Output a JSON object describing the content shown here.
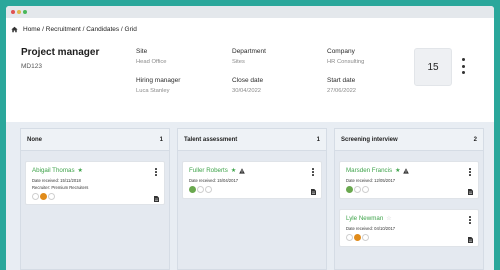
{
  "breadcrumb": [
    "Home",
    "Recruitment",
    "Candidates",
    "Grid"
  ],
  "breadcrumb_separator": " / ",
  "job": {
    "title": "Project manager",
    "code": "MD123",
    "count": "15"
  },
  "fields": {
    "site": {
      "label": "Site",
      "value": "Head Office"
    },
    "department": {
      "label": "Department",
      "value": "Sites"
    },
    "company": {
      "label": "Company",
      "value": "HR Consulting"
    },
    "hiring_manager": {
      "label": "Hiring manager",
      "value": "Luca Stanley"
    },
    "close_date": {
      "label": "Close date",
      "value": "30/04/2022"
    },
    "start_date": {
      "label": "Start date",
      "value": "27/06/2022"
    }
  },
  "columns": [
    {
      "title": "None",
      "count": "1"
    },
    {
      "title": "Talent assessment",
      "count": "1"
    },
    {
      "title": "Screening interview",
      "count": "2"
    }
  ],
  "cards": {
    "abigail": {
      "name": "Abigail Thomas",
      "date": "Date received: 15/11/2018",
      "recruiter": "Recruiter: Premium Recruiters"
    },
    "fuller": {
      "name": "Fuller Roberts",
      "date": "Date received: 15/04/2017"
    },
    "marsden": {
      "name": "Marsden Francis",
      "date": "Date received: 12/05/2017"
    },
    "lyle": {
      "name": "Lyle Newman",
      "date": "Date received: 04/10/2017"
    }
  },
  "colors": {
    "accent_green": "#3ea34a",
    "status_green": "#6aa84f",
    "status_orange": "#e08b1a",
    "background_teal": "#2aa79b"
  },
  "icons": [
    "home-icon",
    "star-icon",
    "warning-icon",
    "document-icon",
    "kebab-menu-icon"
  ]
}
